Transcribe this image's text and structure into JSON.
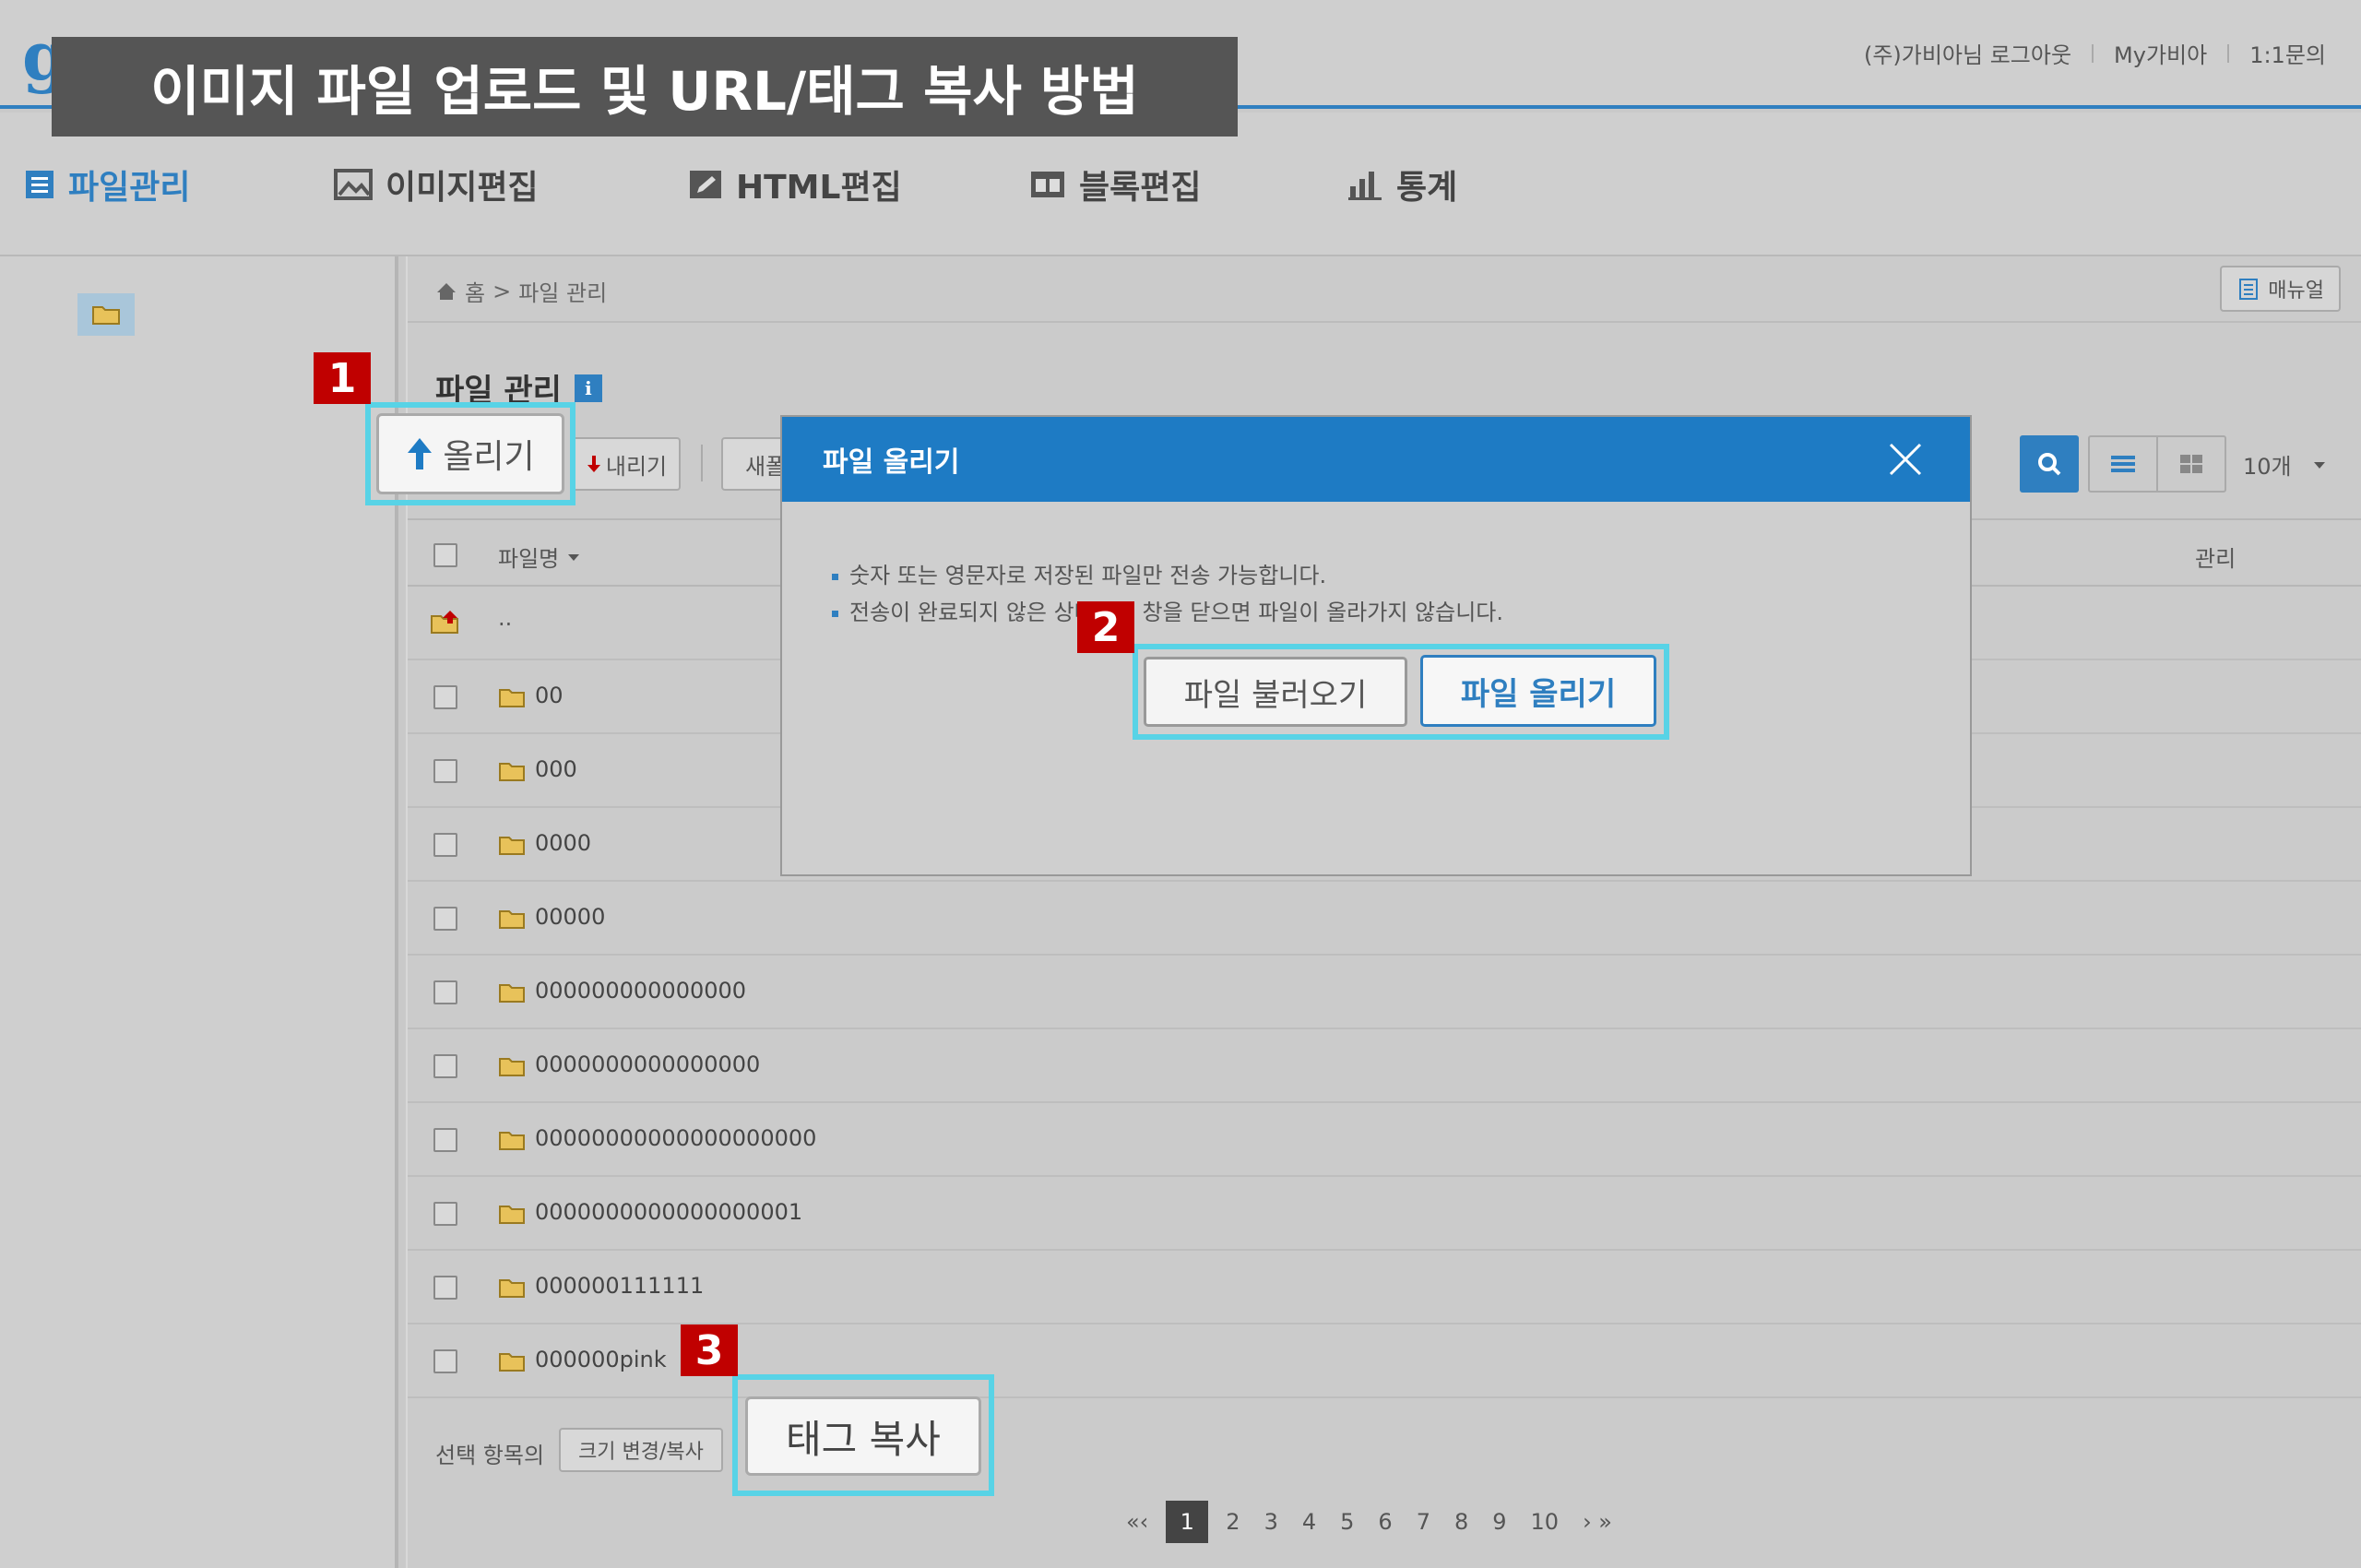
{
  "banner": {
    "title": "이미지 파일 업로드 및 URL/태그 복사 방법"
  },
  "logo": {
    "text": "g"
  },
  "util_links": [
    "(주)가비아님 로그아웃",
    "My가비아",
    "1:1문의"
  ],
  "nav": [
    "파일관리",
    "이미지편집",
    "HTML편집",
    "블록편집",
    "통계"
  ],
  "breadcrumb": {
    "home": "홈",
    "sep": ">",
    "current": "파일 관리"
  },
  "manual_button": "매뉴얼",
  "page_title": "파일 관리",
  "info_icon_label": "i",
  "toolbar": {
    "upload": "올리기",
    "download": "내리기",
    "new_folder": "새폴",
    "count": "10개"
  },
  "table": {
    "col_name": "파일명",
    "col_manage": "관리",
    "parent": "..",
    "rows": [
      "00",
      "000",
      "0000",
      "00000",
      "000000000000000",
      "0000000000000000",
      "00000000000000000000",
      "0000000000000000001",
      "000000111111",
      "000000pink"
    ]
  },
  "bottom": {
    "selected_label": "선택 항목의",
    "resize_copy": "크기 변경/복사",
    "tag_copy": "태그 복사"
  },
  "pagination": {
    "prev": "«‹",
    "pages": [
      "1",
      "2",
      "3",
      "4",
      "5",
      "6",
      "7",
      "8",
      "9",
      "10"
    ],
    "current": "1",
    "next": "› »"
  },
  "modal": {
    "title": "파일 올리기",
    "notes": [
      "숫자 또는 영문자로 저장된 파일만 전송 가능합니다.",
      "전송이 완료되지 않은 상태에서 창을 닫으면 파일이 올라가지 않습니다."
    ],
    "load_button": "파일 불러오기",
    "send_button": "파일 올리기"
  },
  "step_badges": [
    "1",
    "2",
    "3"
  ],
  "colors": {
    "accent": "#2f7fc0",
    "highlight": "#58d3e6",
    "badge": "#c00000",
    "banner": "#555555"
  }
}
